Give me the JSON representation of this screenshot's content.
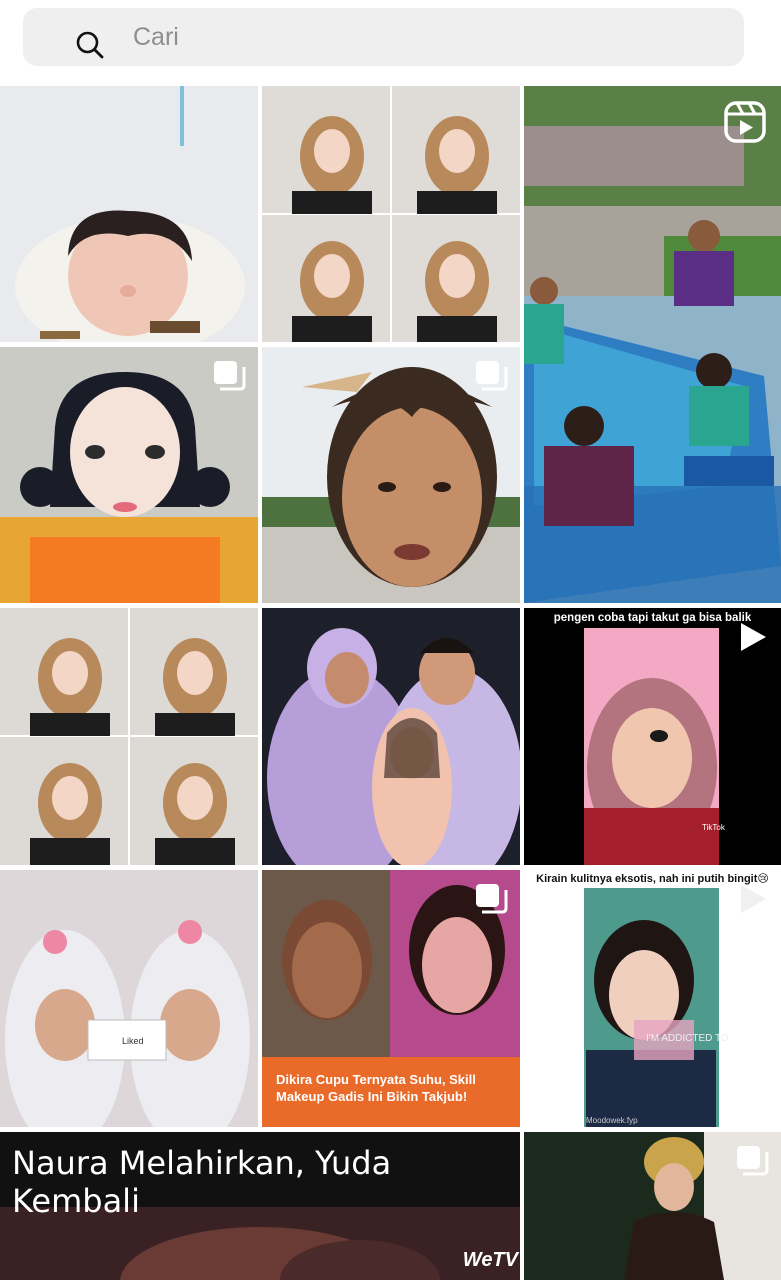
{
  "search": {
    "placeholder": "Cari",
    "icon": "search-icon"
  },
  "grid": {
    "tiles": [
      {
        "name": "newborn-baby-photo",
        "kind": "image"
      },
      {
        "name": "hijab-collage-photo",
        "kind": "image"
      },
      {
        "name": "pool-players-reel",
        "kind": "reel",
        "badge": "reels-icon"
      },
      {
        "name": "makeup-face-carousel",
        "kind": "carousel",
        "badge": "carousel-icon"
      },
      {
        "name": "selfie-headband-carousel",
        "kind": "carousel",
        "badge": "carousel-icon"
      },
      {
        "name": "hijab-collage-photo-2",
        "kind": "image"
      },
      {
        "name": "family-lavender-photo",
        "kind": "image"
      },
      {
        "name": "tiktok-hijab-video",
        "kind": "video",
        "badge": "play-icon",
        "caption": "pengen coba tapi takut ga bisa balik",
        "watermark": "TikTok"
      },
      {
        "name": "hijab-twin-photo",
        "kind": "image",
        "sticker": "Liked"
      },
      {
        "name": "makeup-transformation-carousel",
        "kind": "carousel",
        "badge": "carousel-icon",
        "caption": "Dikira Cupu Ternyata Suhu, Skill Makeup Gadis Ini Bikin Takjub!"
      },
      {
        "name": "exotic-skin-video",
        "kind": "video",
        "badge": "play-icon",
        "caption": "Kirain kulitnya eksotis, nah ini putih bingit😢",
        "overlay": "I'M ADDICTED TO",
        "handle": "Moodowek.fyp"
      },
      {
        "name": "naura-banner",
        "kind": "image",
        "title": "Naura Melahirkan, Yuda Kembali",
        "brand": "WeTV"
      },
      {
        "name": "bride-traditional-carousel",
        "kind": "carousel",
        "badge": "carousel-icon"
      }
    ]
  },
  "colors": {
    "search_bg": "#efefef",
    "placeholder": "#8e8e8e",
    "orange_caption": "#ea6a2a"
  }
}
